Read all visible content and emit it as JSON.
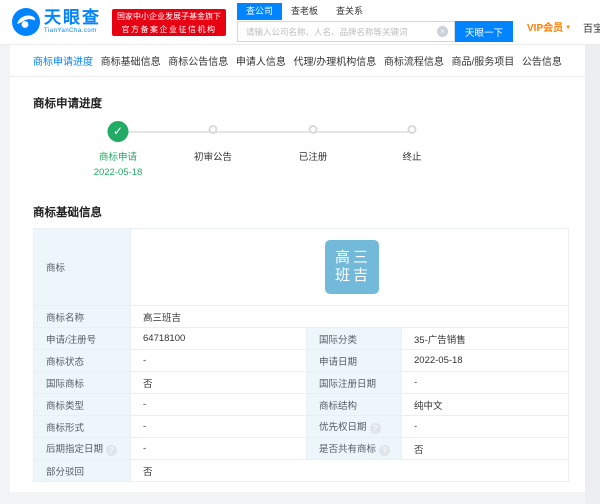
{
  "brand": {
    "name": "天眼查",
    "domain": "TianYanCha.com",
    "badge_line1": "国家中小企业发展子基金旗下",
    "badge_line2": "官方备案企业征信机构"
  },
  "header": {
    "search_tabs": [
      {
        "label": "查公司",
        "active": true
      },
      {
        "label": "查老板",
        "active": false
      },
      {
        "label": "查关系",
        "active": false
      }
    ],
    "search_placeholder": "请输入公司名称、人名、品牌名称等关键词",
    "clear_icon": "×",
    "search_button": "天眼一下",
    "vip_label": "VIP会员",
    "vip_caret": "▼",
    "toolbox_partial": "百宝"
  },
  "nav_tabs": [
    {
      "label": "商标申请进度",
      "active": true
    },
    {
      "label": "商标基础信息",
      "active": false
    },
    {
      "label": "商标公告信息",
      "active": false
    },
    {
      "label": "申请人信息",
      "active": false
    },
    {
      "label": "代理/办理机构信息",
      "active": false
    },
    {
      "label": "商标流程信息",
      "active": false
    },
    {
      "label": "商品/服务项目",
      "active": false
    },
    {
      "label": "公告信息",
      "active": false
    }
  ],
  "progress": {
    "title": "商标申请进度",
    "check_icon": "✓",
    "steps": [
      {
        "label": "商标申请",
        "date": "2022-05-18",
        "done": true
      },
      {
        "label": "初审公告",
        "done": false
      },
      {
        "label": "已注册",
        "done": false
      },
      {
        "label": "终止",
        "done": false
      }
    ]
  },
  "basic": {
    "title": "商标基础信息",
    "mark_row_label": "商标",
    "mark_image": {
      "line1": "高三",
      "line2": "班吉"
    },
    "info_icon": "?",
    "rows": [
      {
        "type": "full",
        "label": "商标名称",
        "value": "高三班吉"
      },
      {
        "type": "pair",
        "l1": "申请/注册号",
        "v1": "64718100",
        "l2": "国际分类",
        "v2": "35-广告销售"
      },
      {
        "type": "pair",
        "l1": "商标状态",
        "v1": "-",
        "l2": "申请日期",
        "v2": "2022-05-18"
      },
      {
        "type": "pair",
        "l1": "国际商标",
        "v1": "否",
        "l2": "国际注册日期",
        "v2": "-"
      },
      {
        "type": "pair",
        "l1": "商标类型",
        "v1": "-",
        "l2": "商标结构",
        "v2": "纯中文"
      },
      {
        "type": "pair",
        "l1": "商标形式",
        "v1": "-",
        "l2": "优先权日期",
        "i2": true,
        "v2": "-"
      },
      {
        "type": "pair",
        "l1": "后期指定日期",
        "i1": true,
        "v1": "-",
        "l2": "是否共有商标",
        "i2": true,
        "v2": "否"
      },
      {
        "type": "full",
        "label": "部分驳回",
        "value": "否"
      }
    ]
  },
  "colors": {
    "accent_blue": "#0084ff",
    "badge_red": "#e60012",
    "vip_orange": "#ff7e00",
    "step_green": "#21ab64",
    "mark_bg": "#72b9da",
    "label_cell_bg": "#edf6fb"
  }
}
